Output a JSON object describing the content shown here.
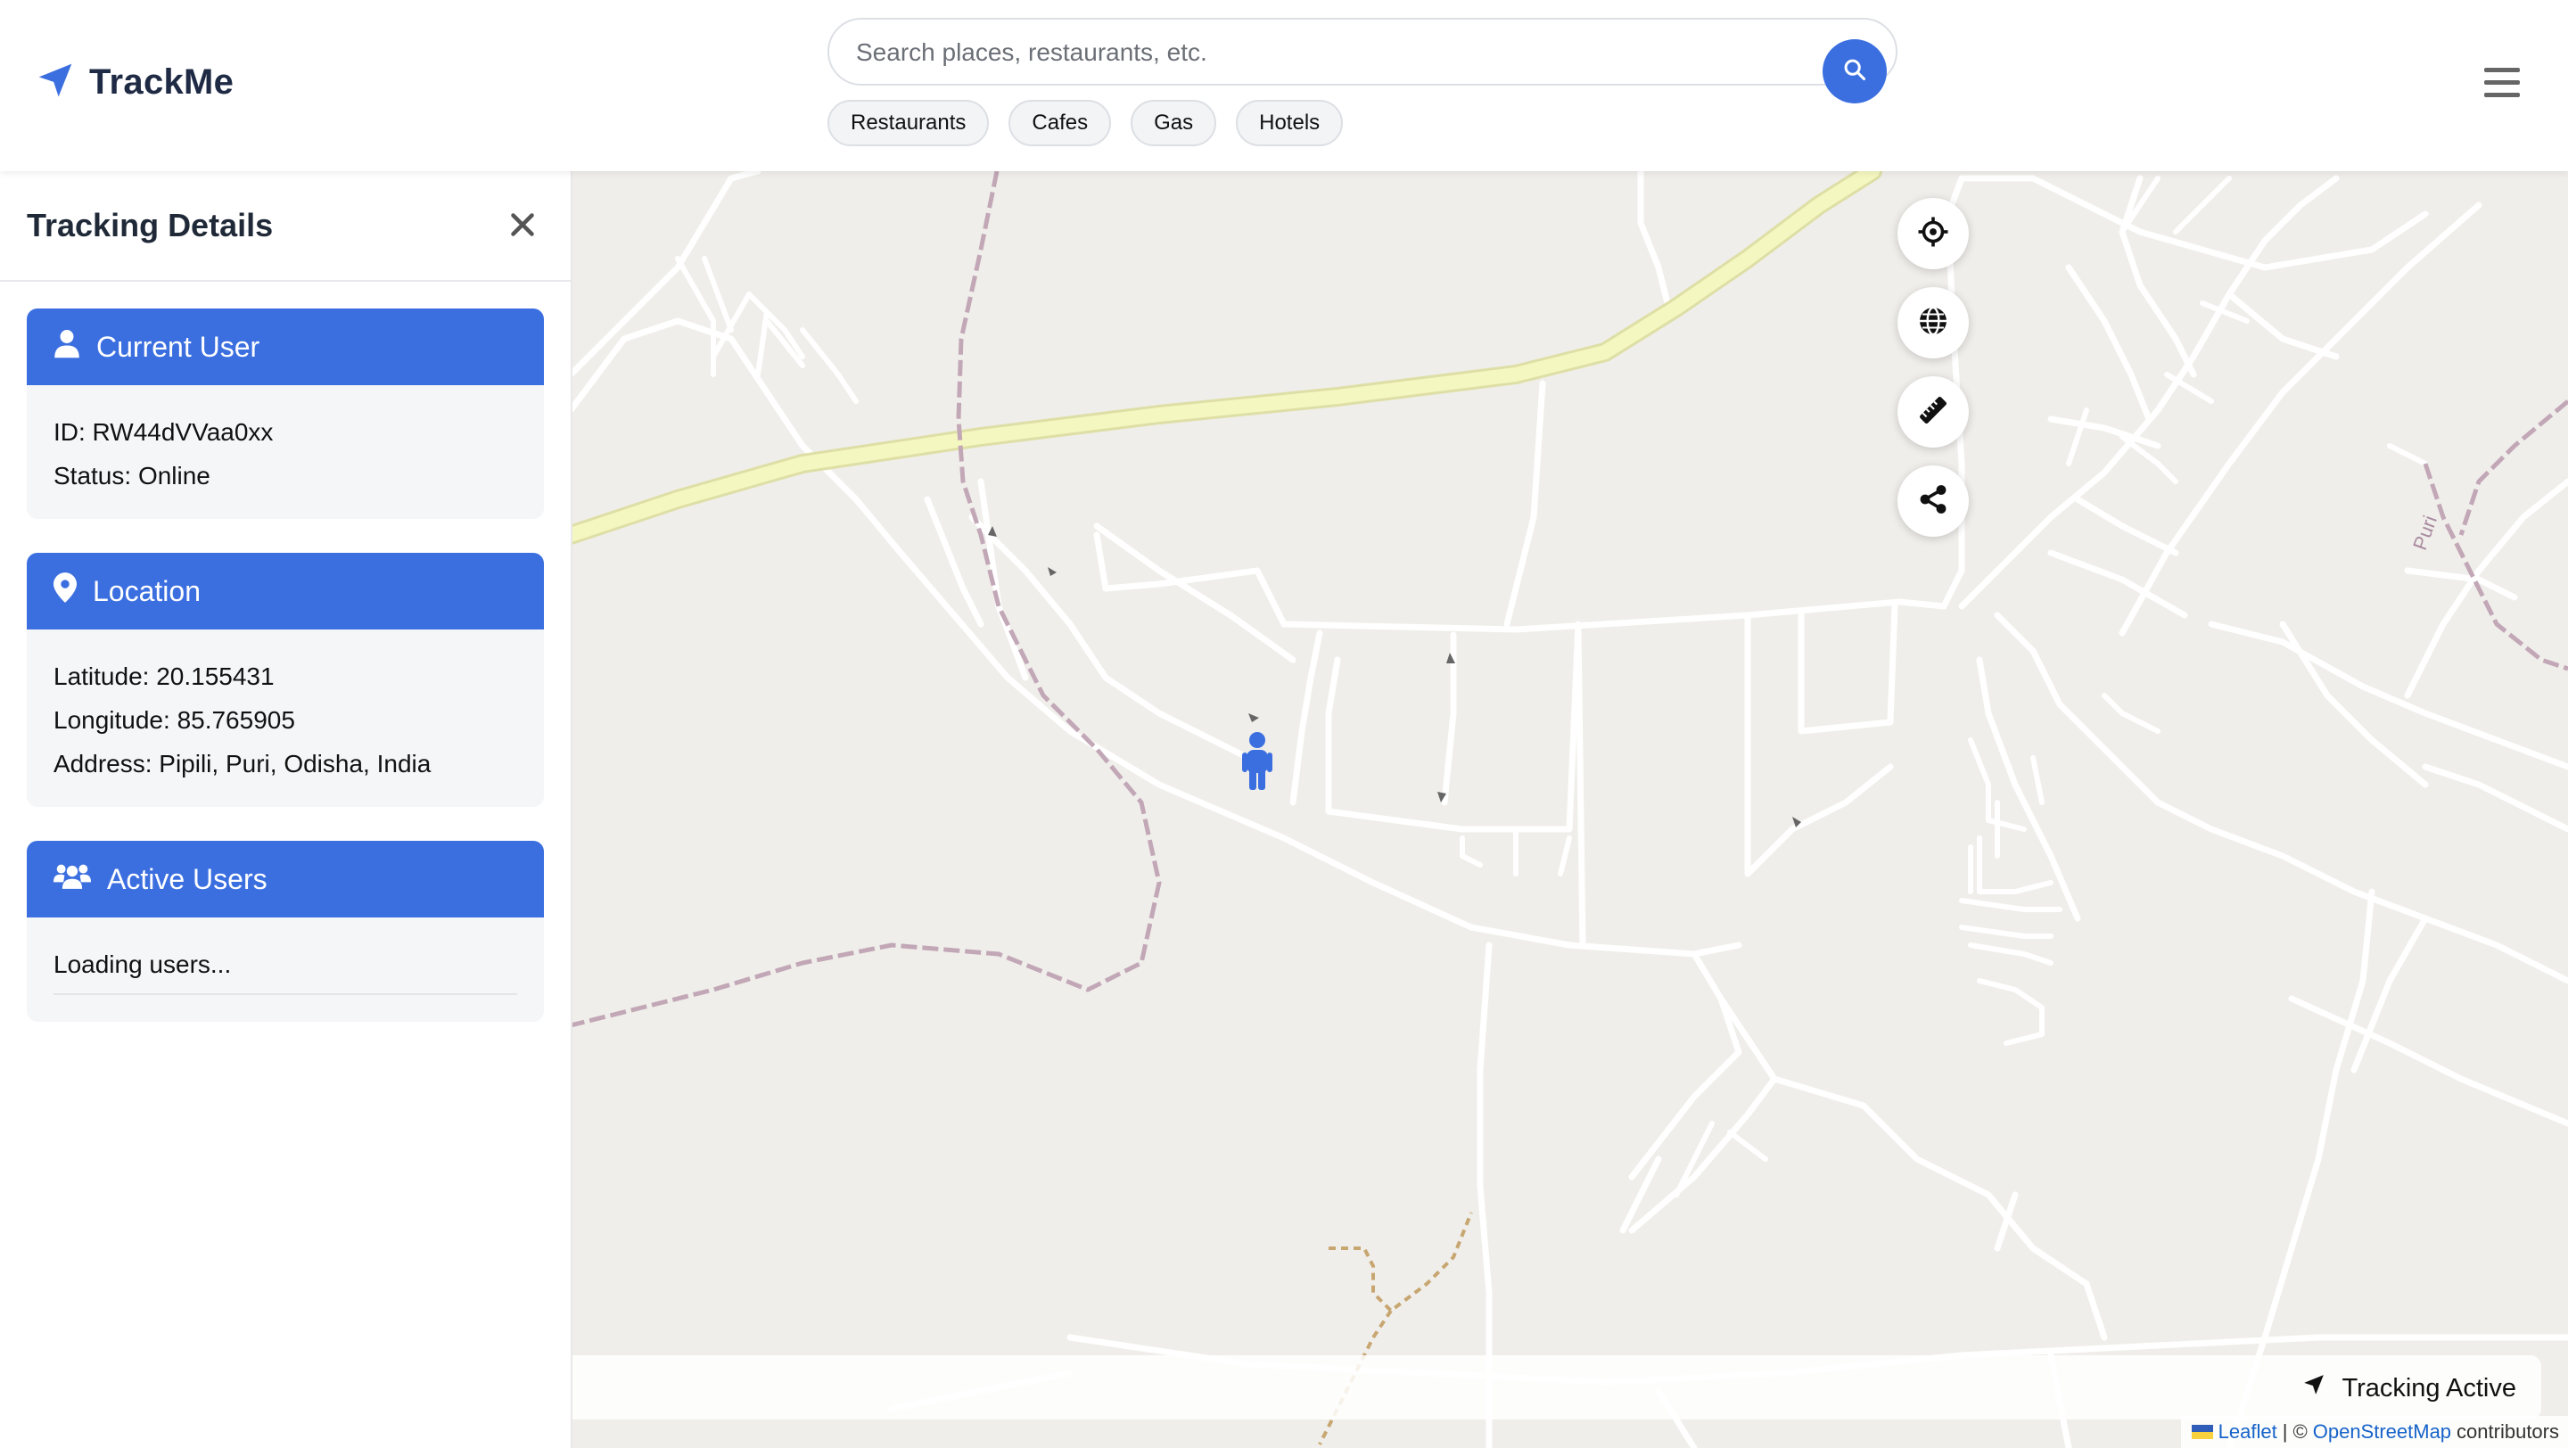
{
  "header": {
    "brand": "TrackMe",
    "search_placeholder": "Search places, restaurants, etc.",
    "chips": [
      "Restaurants",
      "Cafes",
      "Gas",
      "Hotels"
    ]
  },
  "sidebar": {
    "title": "Tracking Details",
    "current_user": {
      "heading": "Current User",
      "id_line": "ID: RW44dVVaa0xx",
      "status_line": "Status: Online"
    },
    "location": {
      "heading": "Location",
      "latitude_line": "Latitude: 20.155431",
      "longitude_line": "Longitude: 85.765905",
      "address_line": "Address: Pipili, Puri, Odisha, India"
    },
    "active_users": {
      "heading": "Active Users",
      "loading_text": "Loading users..."
    }
  },
  "map": {
    "road_label": "Puri",
    "status_text": "Tracking Active",
    "attribution": {
      "leaflet": "Leaflet",
      "separator": "| ©",
      "osm": "OpenStreetMap",
      "suffix": "contributors"
    },
    "controls": [
      "locate-icon",
      "globe-icon",
      "ruler-icon",
      "share-icon"
    ]
  },
  "colors": {
    "accent": "#3b6fe0",
    "map_background": "#f0eeea",
    "highway": "#f5f7c0"
  }
}
